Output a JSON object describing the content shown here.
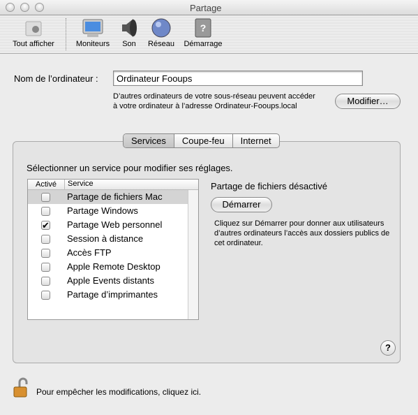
{
  "window": {
    "title": "Partage"
  },
  "toolbar": {
    "items": [
      {
        "label": "Tout afficher",
        "icon": "apple-icon"
      },
      {
        "label": "Moniteurs",
        "icon": "monitor-icon"
      },
      {
        "label": "Son",
        "icon": "speaker-icon"
      },
      {
        "label": "Réseau",
        "icon": "globe-icon"
      },
      {
        "label": "Démarrage",
        "icon": "disk-icon"
      }
    ]
  },
  "computer": {
    "label": "Nom de l’ordinateur :",
    "value": "Ordinateur Fooups",
    "info": "D’autres ordinateurs de votre sous-réseau peuvent accéder à votre ordinateur à l’adresse Ordinateur-Fooups.local",
    "edit_button": "Modifier…"
  },
  "tabs": [
    {
      "label": "Services",
      "selected": true
    },
    {
      "label": "Coupe-feu"
    },
    {
      "label": "Internet"
    }
  ],
  "services": {
    "prompt": "Sélectionner un service pour modifier ses réglages.",
    "col_active": "Activé",
    "col_service": "Service",
    "rows": [
      {
        "name": "Partage de fichiers Mac",
        "checked": false,
        "selected": true
      },
      {
        "name": "Partage Windows",
        "checked": false
      },
      {
        "name": "Partage Web personnel",
        "checked": true
      },
      {
        "name": "Session à distance",
        "checked": false
      },
      {
        "name": "Accès FTP",
        "checked": false
      },
      {
        "name": "Apple Remote Desktop",
        "checked": false
      },
      {
        "name": "Apple Events distants",
        "checked": false
      },
      {
        "name": "Partage d’imprimantes",
        "checked": false
      }
    ],
    "status": "Partage de fichiers désactivé",
    "start_button": "Démarrer",
    "description": "Cliquez sur Démarrer pour donner aux utilisateurs d’autres ordinateurs l’accès aux dossiers publics de cet ordinateur.",
    "help": "?"
  },
  "lock": {
    "text": "Pour empêcher les modifications, cliquez ici."
  }
}
